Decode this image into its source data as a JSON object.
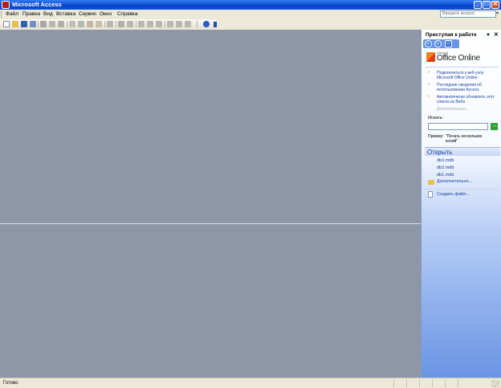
{
  "window": {
    "title": "Microsoft Access",
    "controls": {
      "minimize": "_",
      "maximize": "□",
      "close": "✕"
    }
  },
  "menu": {
    "items": [
      {
        "label": "Файл"
      },
      {
        "label": "Правка"
      },
      {
        "label": "Вид"
      },
      {
        "label": "Вставка"
      },
      {
        "label": "Сервис"
      },
      {
        "label": "Окно"
      },
      {
        "label": "Справка"
      }
    ],
    "help_search_placeholder": "Введите вопрос"
  },
  "toolbar": {
    "icons": [
      "new-icon",
      "open-icon",
      "save-icon",
      "search-file-icon",
      "print-icon",
      "print-preview-icon",
      "spelling-icon",
      "cut-icon",
      "copy-icon",
      "paste-icon",
      "format-painter-icon",
      "undo-icon",
      "office-links-icon",
      "analyze-icon",
      "code-icon",
      "script-icon",
      "properties-icon",
      "relationships-icon",
      "new-object-icon",
      "help-icon"
    ]
  },
  "task_pane": {
    "title": "Приступая к работе",
    "dropdown": "▼",
    "close": "✕",
    "logo_small": "Microsoft",
    "logo_text": "Office Online",
    "links": [
      {
        "text": "Подключиться к веб-узлу Microsoft Office Online"
      },
      {
        "text": "Последние сведения об использовании Access"
      },
      {
        "text": "Автоматически обновлять этот список из Веба"
      }
    ],
    "more_link": "Дополнительно...",
    "search_label": "Искать:",
    "search_go": "→",
    "example_label": "Пример:",
    "example_text": "\"Печать нескольких копий\"",
    "open_section": {
      "title": "Открыть",
      "files": [
        "db3.mdb",
        "db2.mdb",
        "db1.mdb"
      ],
      "more": "Дополнительно...",
      "create_file": "Создать файл..."
    }
  },
  "status_bar": {
    "text": "Готово"
  },
  "colors": {
    "titlebar": "#0A44C8",
    "workspace": "#8F96A8",
    "chrome": "#ECE9D8",
    "link": "#1B3F9C"
  }
}
